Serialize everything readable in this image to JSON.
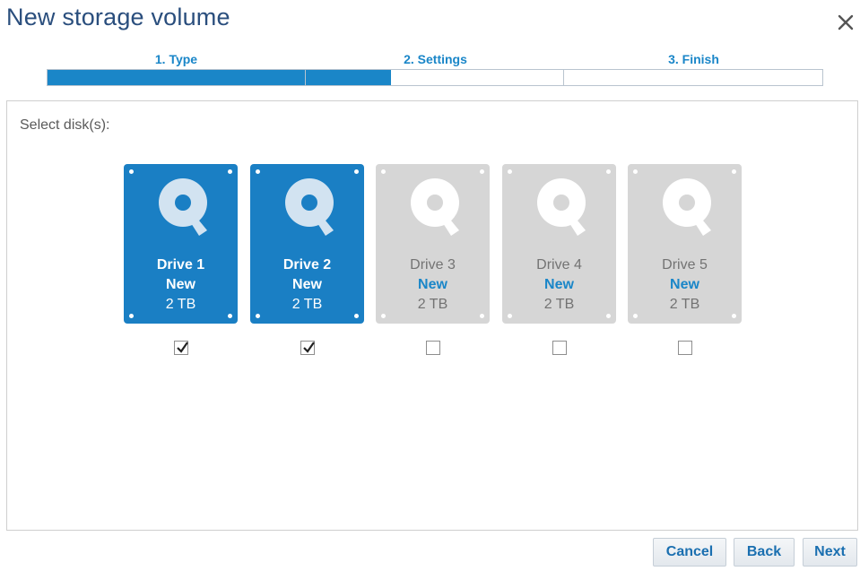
{
  "dialog": {
    "title": "New storage volume"
  },
  "steps": [
    {
      "label": "1. Type",
      "progress": 1.0
    },
    {
      "label": "2. Settings",
      "progress": 0.33
    },
    {
      "label": "3. Finish",
      "progress": 0.0
    }
  ],
  "panel": {
    "select_label": "Select disk(s):"
  },
  "drives": [
    {
      "name": "Drive 1",
      "status": "New",
      "size": "2 TB",
      "selected": true
    },
    {
      "name": "Drive 2",
      "status": "New",
      "size": "2 TB",
      "selected": true
    },
    {
      "name": "Drive 3",
      "status": "New",
      "size": "2 TB",
      "selected": false
    },
    {
      "name": "Drive 4",
      "status": "New",
      "size": "2 TB",
      "selected": false
    },
    {
      "name": "Drive 5",
      "status": "New",
      "size": "2 TB",
      "selected": false
    }
  ],
  "buttons": {
    "cancel": "Cancel",
    "back": "Back",
    "next": "Next"
  },
  "colors": {
    "accent": "#1a86c8",
    "selected_tile": "#1a7fc4",
    "unselected_tile": "#d6d6d6",
    "title": "#2a4e7d"
  },
  "icons": {
    "close": "close-icon",
    "disk": "hard-disk-icon",
    "check": "checkmark-icon"
  }
}
